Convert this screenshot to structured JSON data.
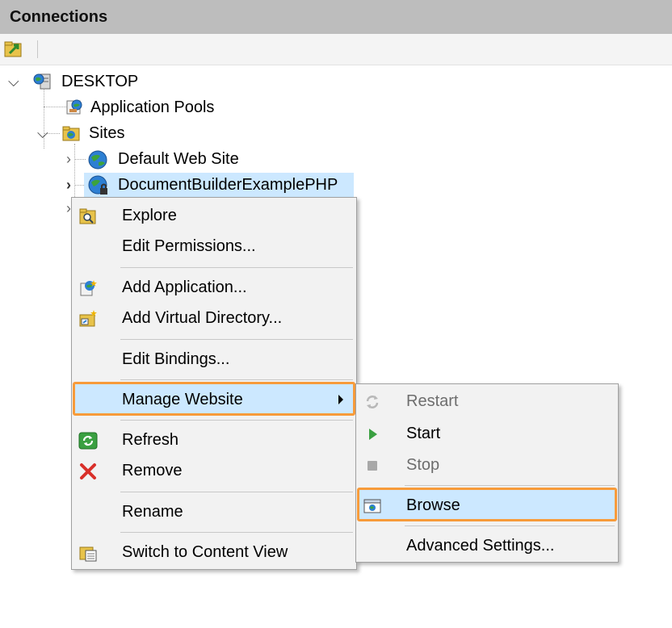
{
  "header": {
    "title": "Connections"
  },
  "toolbar": {
    "connect_icon": "connect-icon"
  },
  "tree": {
    "server": {
      "label": "DESKTOP",
      "icon": "server-globe-icon"
    },
    "app_pools": {
      "label": "Application Pools",
      "icon": "app-pools-icon"
    },
    "sites": {
      "label": "Sites",
      "icon": "sites-folder-icon"
    },
    "default_site": {
      "label": "Default Web Site",
      "icon": "globe-icon"
    },
    "selected_site": {
      "label": "DocumentBuilderExamplePHP",
      "icon": "globe-lock-icon"
    }
  },
  "context_menu": {
    "items": [
      {
        "label": "Explore",
        "icon": "explore-folder-icon"
      },
      {
        "label": "Edit Permissions..."
      },
      {
        "label": "Add Application...",
        "icon": "add-application-icon"
      },
      {
        "label": "Add Virtual Directory...",
        "icon": "add-virtual-directory-icon"
      },
      {
        "label": "Edit Bindings..."
      },
      {
        "label": "Manage Website",
        "submenu": true
      },
      {
        "label": "Refresh",
        "icon": "refresh-icon"
      },
      {
        "label": "Remove",
        "icon": "remove-x-icon"
      },
      {
        "label": "Rename"
      },
      {
        "label": "Switch to Content View",
        "icon": "content-view-icon"
      }
    ]
  },
  "submenu": {
    "items": [
      {
        "label": "Restart",
        "enabled": false,
        "icon": "restart-icon"
      },
      {
        "label": "Start",
        "enabled": true,
        "icon": "play-icon"
      },
      {
        "label": "Stop",
        "enabled": false,
        "icon": "stop-icon"
      },
      {
        "label": "Browse",
        "enabled": true,
        "icon": "browse-icon"
      },
      {
        "label": "Advanced Settings...",
        "enabled": true
      }
    ]
  },
  "colors": {
    "highlight": "#cce8ff",
    "callout": "#f79b3a",
    "header_bg": "#bdbdbd"
  }
}
